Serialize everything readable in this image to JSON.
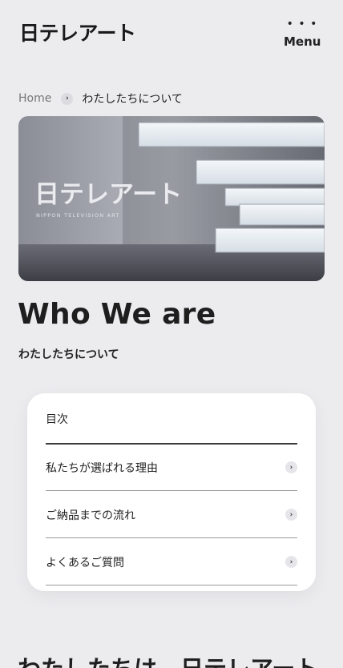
{
  "header": {
    "logo_text": "日テレアート",
    "menu_icon": "ellipsis-icon",
    "menu_label": "Menu"
  },
  "breadcrumb": {
    "home": "Home",
    "separator_icon": "chevron-right-icon",
    "current": "わたしたちについて"
  },
  "hero": {
    "sign_logo": "日テレアート",
    "sign_caption": "NIPPON TELEVISION ART"
  },
  "page": {
    "title": "Who We are",
    "subtitle": "わたしたちについて"
  },
  "toc": {
    "heading": "目次",
    "items": [
      {
        "label": "私たちが選ばれる理由"
      },
      {
        "label": "ご納品までの流れ"
      },
      {
        "label": "よくあるご質問"
      }
    ],
    "item_icon": "chevron-right-icon"
  },
  "section": {
    "heading": "わたしたちは、日テレアート"
  },
  "colors": {
    "background": "#ececef",
    "card": "#ffffff",
    "text": "#1f1f1f"
  }
}
